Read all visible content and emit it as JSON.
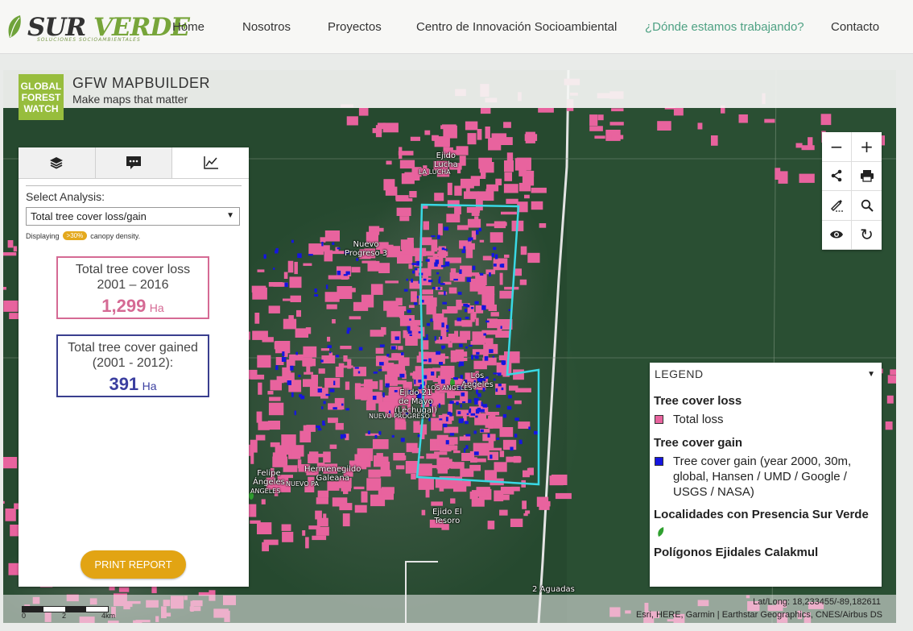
{
  "site": {
    "logo_text_a": "SUR ",
    "logo_text_b": "VERDE",
    "logo_tagline": "SOLUCIONES SOCIOAMBIENTALES",
    "nav": [
      {
        "label": "Home"
      },
      {
        "label": "Nosotros"
      },
      {
        "label": "Proyectos"
      },
      {
        "label": "Centro de Innovación Socioambiental"
      },
      {
        "label": "¿Dónde estamos trabajando?"
      },
      {
        "label": "Contacto"
      }
    ],
    "accent_color": "#4ea183"
  },
  "gfw": {
    "logo_lines": [
      "GLOBAL",
      "FOREST",
      "WATCH"
    ],
    "title": "GFW MAPBUILDER",
    "subtitle": "Make maps that matter",
    "brand_color": "#97bd3d"
  },
  "panel": {
    "tabs": [
      {
        "icon": "layers-icon"
      },
      {
        "icon": "comment-icon"
      },
      {
        "icon": "chart-icon"
      }
    ],
    "select_label": "Select Analysis:",
    "select_value": "Total tree cover loss/gain",
    "density_prefix": "Displaying",
    "density_value": ">30%",
    "density_suffix": "canopy density.",
    "loss": {
      "title_line1": "Total tree cover loss",
      "title_line2": "2001 – 2016",
      "value": "1,299",
      "unit": "Ha",
      "color": "#d56a94"
    },
    "gain": {
      "title_line1": "Total tree cover gained",
      "title_line2": "(2001 - 2012):",
      "value": "391",
      "unit": "Ha",
      "color": "#3b3fa0"
    },
    "print_label": "PRINT REPORT",
    "print_color": "#e2a413"
  },
  "controls": [
    {
      "icon": "minus-icon",
      "glyph": "−"
    },
    {
      "icon": "plus-icon",
      "glyph": "+"
    },
    {
      "icon": "share-icon",
      "glyph": "⋖"
    },
    {
      "icon": "print-icon",
      "glyph": "⎙"
    },
    {
      "icon": "measure-icon",
      "glyph": "✎"
    },
    {
      "icon": "search-icon",
      "glyph": "⚲"
    },
    {
      "icon": "eye-icon",
      "glyph": "◉"
    },
    {
      "icon": "refresh-icon",
      "glyph": "↻"
    }
  ],
  "legend": {
    "header": "LEGEND",
    "loss_section": "Tree cover loss",
    "loss_item": "Total loss",
    "loss_color": "#e8639e",
    "gain_section": "Tree cover gain",
    "gain_item": "Tree cover gain (year 2000, 30m, global, Hansen / UMD / Google / USGS / NASA)",
    "gain_color": "#1515e0",
    "localidades_section": "Localidades con Presencia Sur Verde",
    "localidades_color": "#2fa02f",
    "poligonos_section": "Polígonos Ejidales Calakmul",
    "polygon_color": "#39d8e4"
  },
  "map_labels": {
    "ejido_lucha": "Ejido\nLucha",
    "la_lucha": "LA LUCHA",
    "nuevo_progreso_3": "Nuevo\nProgreso 3",
    "los_angeles": "Los\nAngeles",
    "los_angeles_caps": "LOS ANGELES",
    "ejido_21_mayo": "Ejido 21\nde Mayo\n(Lechugal)",
    "nuevo_progreso_caps": "NUEVO PROGRESO",
    "felipe_angeles": "Felipe\nÁngeles",
    "angeles_caps": "ANGELES",
    "hermenegildo": "Hermenegildo\nGaleana",
    "nuevo_pa_caps": "NUEVO PA",
    "ejido_el_tesoro": "Ejido El\nTesoro",
    "dos_aguadas": "2 Aguadas"
  },
  "map_footer": {
    "scale_labels": [
      "0",
      "2",
      "4km"
    ],
    "latlong": "Lat/Long: 18,233455/-89,182611",
    "attribution": "Esri, HERE, Garmin | Earthstar Geographics, CNES/Airbus DS"
  }
}
